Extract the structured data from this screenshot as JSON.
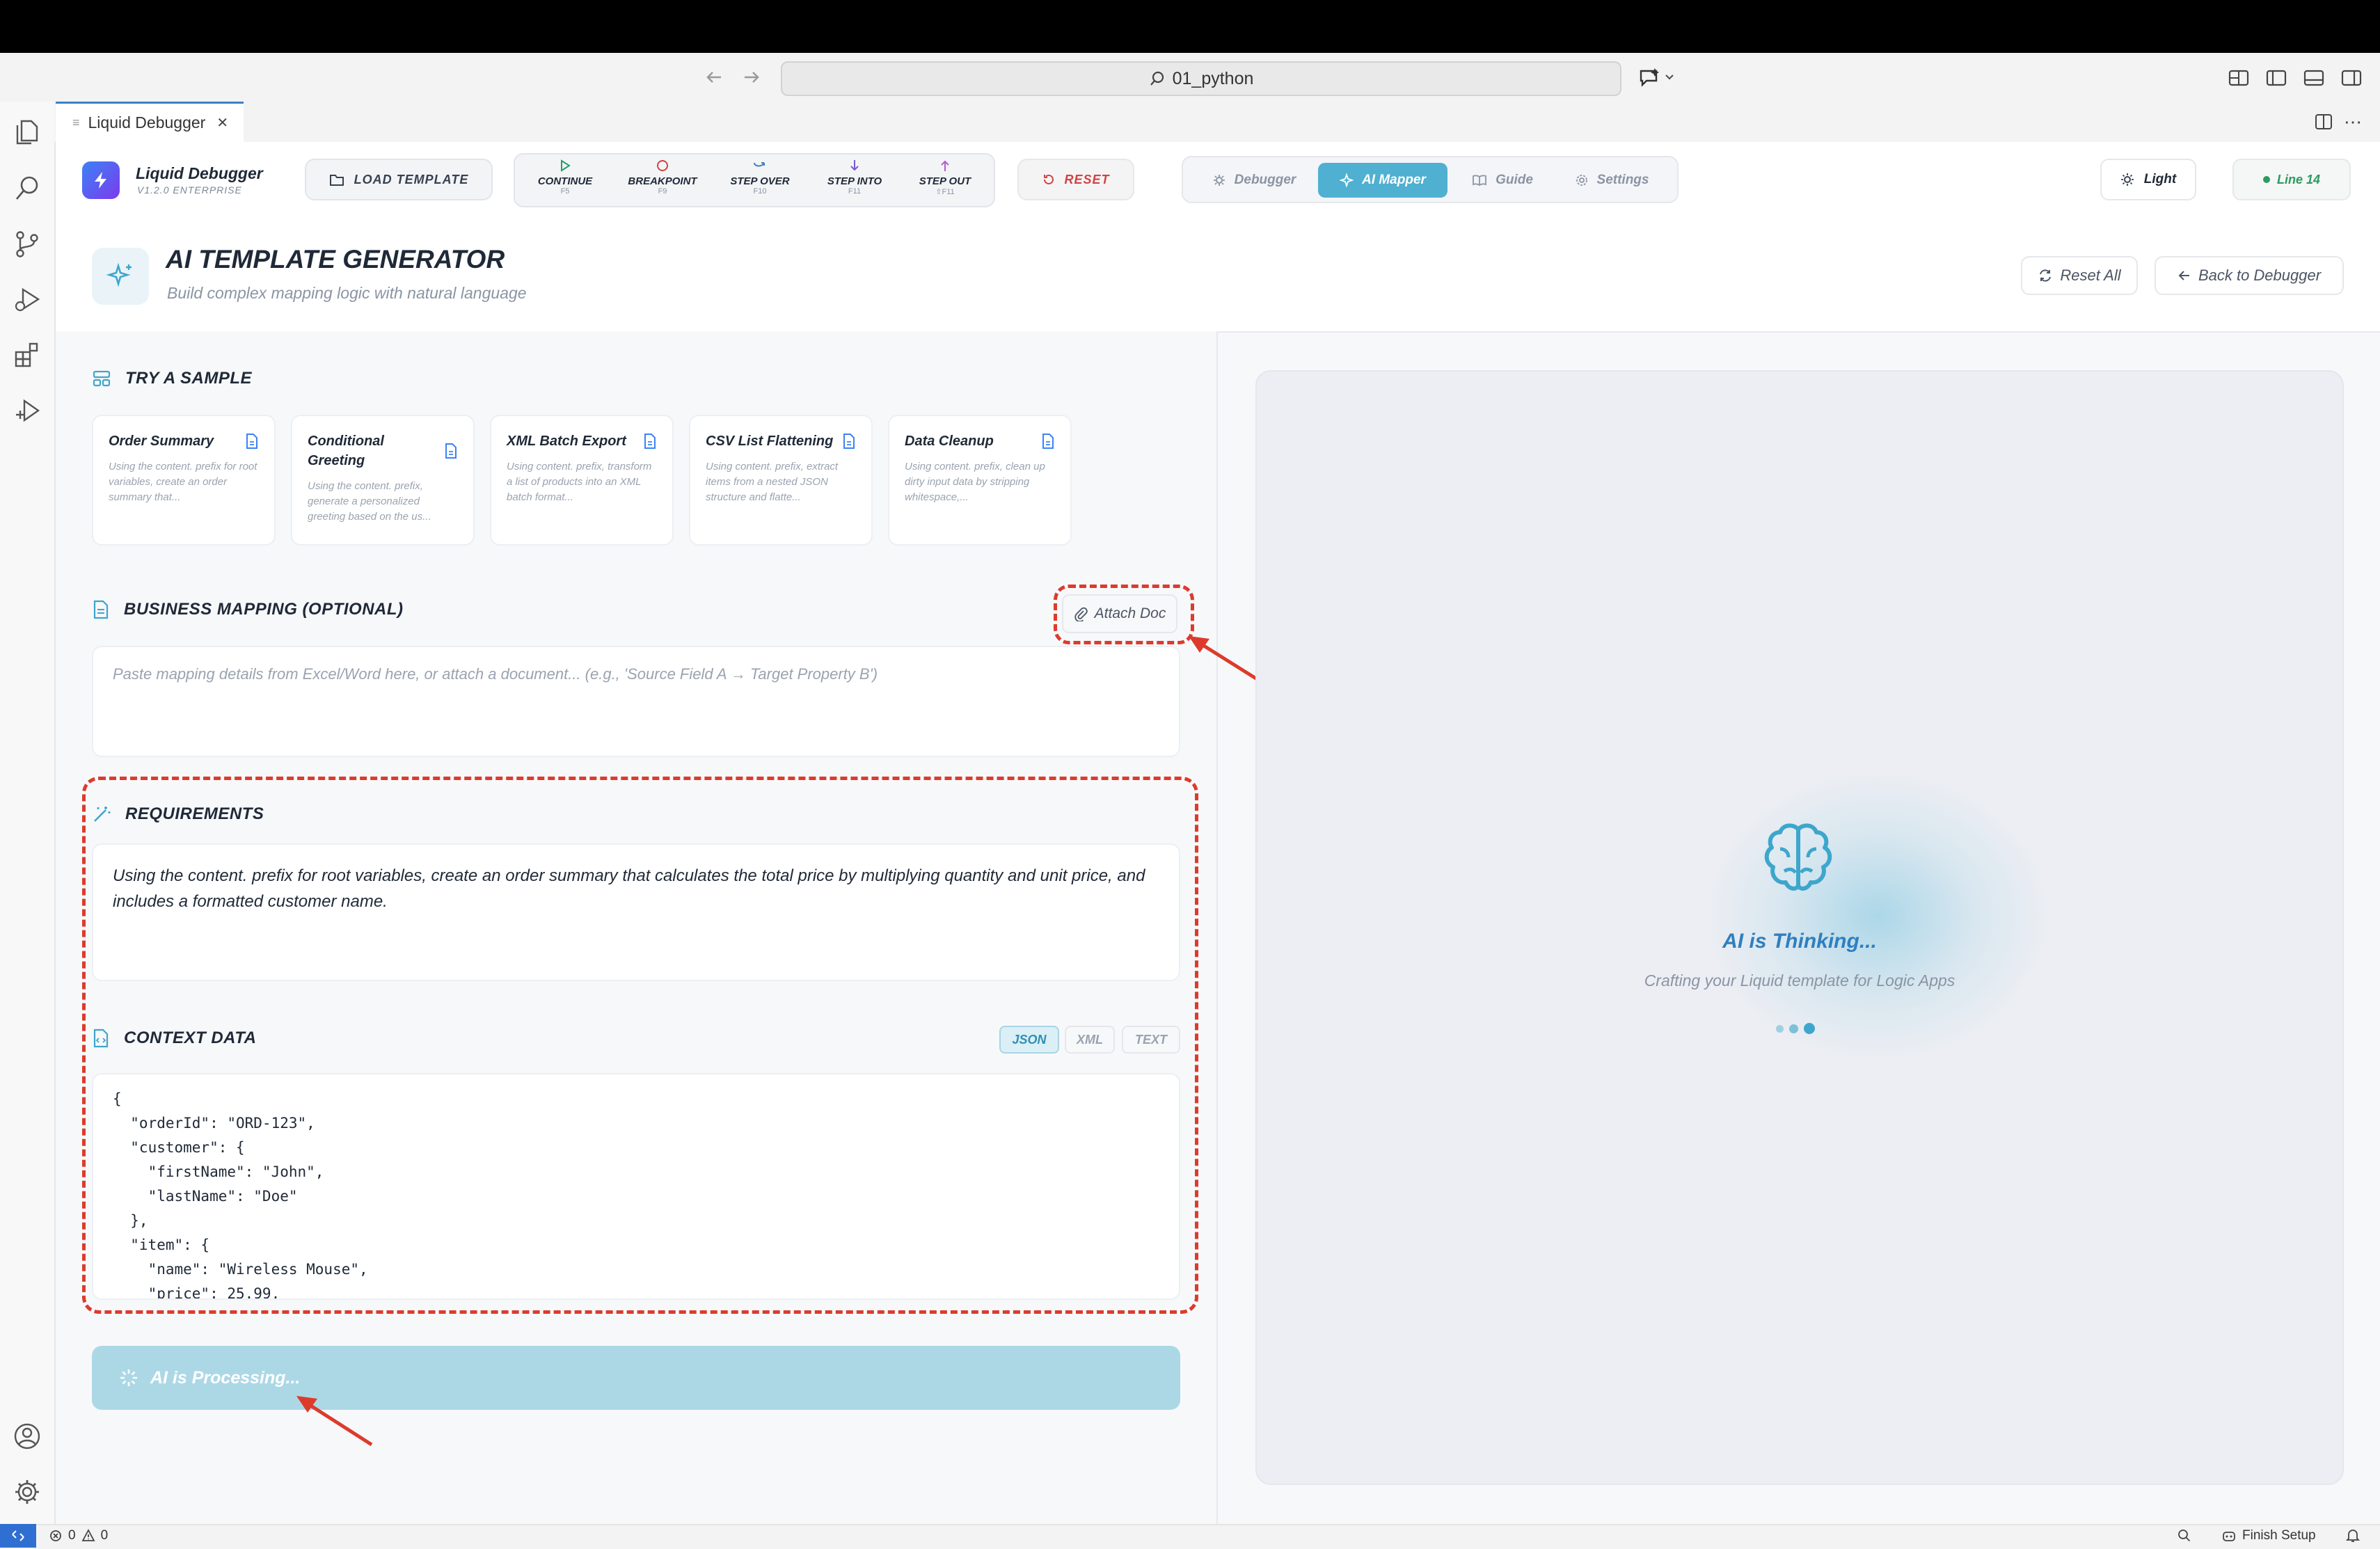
{
  "window": {
    "address": "01_python"
  },
  "tab": {
    "label": "Liquid Debugger",
    "close": "✕"
  },
  "brand": {
    "name": "Liquid Debugger",
    "version": "V1.2.0 ENTERPRISE"
  },
  "toolbar": {
    "load_template": "LOAD TEMPLATE",
    "steps": [
      {
        "label": "CONTINUE",
        "key": "F5"
      },
      {
        "label": "BREAKPOINT",
        "key": "F9"
      },
      {
        "label": "STEP OVER",
        "key": "F10"
      },
      {
        "label": "STEP INTO",
        "key": "F11"
      },
      {
        "label": "STEP OUT",
        "key": "⇧F11"
      }
    ],
    "reset": "RESET",
    "nav": [
      {
        "label": "Debugger"
      },
      {
        "label": "AI Mapper",
        "active": true
      },
      {
        "label": "Guide"
      },
      {
        "label": "Settings"
      }
    ],
    "theme": "Light",
    "line": "Line 14"
  },
  "header": {
    "title": "AI TEMPLATE GENERATOR",
    "subtitle": "Build complex mapping logic with natural language",
    "reset_all": "Reset All",
    "back": "Back to Debugger"
  },
  "samples": {
    "heading": "TRY A SAMPLE",
    "items": [
      {
        "title": "Order Summary",
        "desc": "Using the content. prefix for root variables, create an order summary that..."
      },
      {
        "title": "Conditional Greeting",
        "desc": "Using the content. prefix, generate a personalized greeting based on the us..."
      },
      {
        "title": "XML Batch Export",
        "desc": "Using content. prefix, transform a list of products into an XML batch format..."
      },
      {
        "title": "CSV List Flattening",
        "desc": "Using content. prefix, extract items from a nested JSON structure and flatte..."
      },
      {
        "title": "Data Cleanup",
        "desc": "Using content. prefix, clean up dirty input data by stripping whitespace,..."
      }
    ]
  },
  "business": {
    "heading": "BUSINESS MAPPING (OPTIONAL)",
    "attach": "Attach Doc",
    "placeholder": "Paste mapping details from Excel/Word here, or attach a document... (e.g., 'Source Field A → Target Property B')"
  },
  "requirements": {
    "heading": "REQUIREMENTS",
    "text": "Using the content. prefix for root variables, create an order summary that calculates the total price by multiplying quantity and unit price, and includes a formatted customer name."
  },
  "context": {
    "heading": "CONTEXT DATA",
    "formats": [
      "JSON",
      "XML",
      "TEXT"
    ],
    "active_format": "JSON",
    "code": "{\n  \"orderId\": \"ORD-123\",\n  \"customer\": {\n    \"firstName\": \"John\",\n    \"lastName\": \"Doe\"\n  },\n  \"item\": {\n    \"name\": \"Wireless Mouse\",\n    \"price\": 25.99,"
  },
  "processing": {
    "label": "AI is Processing..."
  },
  "thinking": {
    "title": "AI is Thinking...",
    "subtitle": "Crafting your Liquid template for Logic Apps"
  },
  "statusbar": {
    "errors": "0",
    "warnings": "0",
    "finish_setup": "Finish Setup"
  },
  "colors": {
    "accent": "#4fb0d1",
    "annotation": "#dc3b2c",
    "danger": "#d14343",
    "success": "#2e9a62"
  }
}
